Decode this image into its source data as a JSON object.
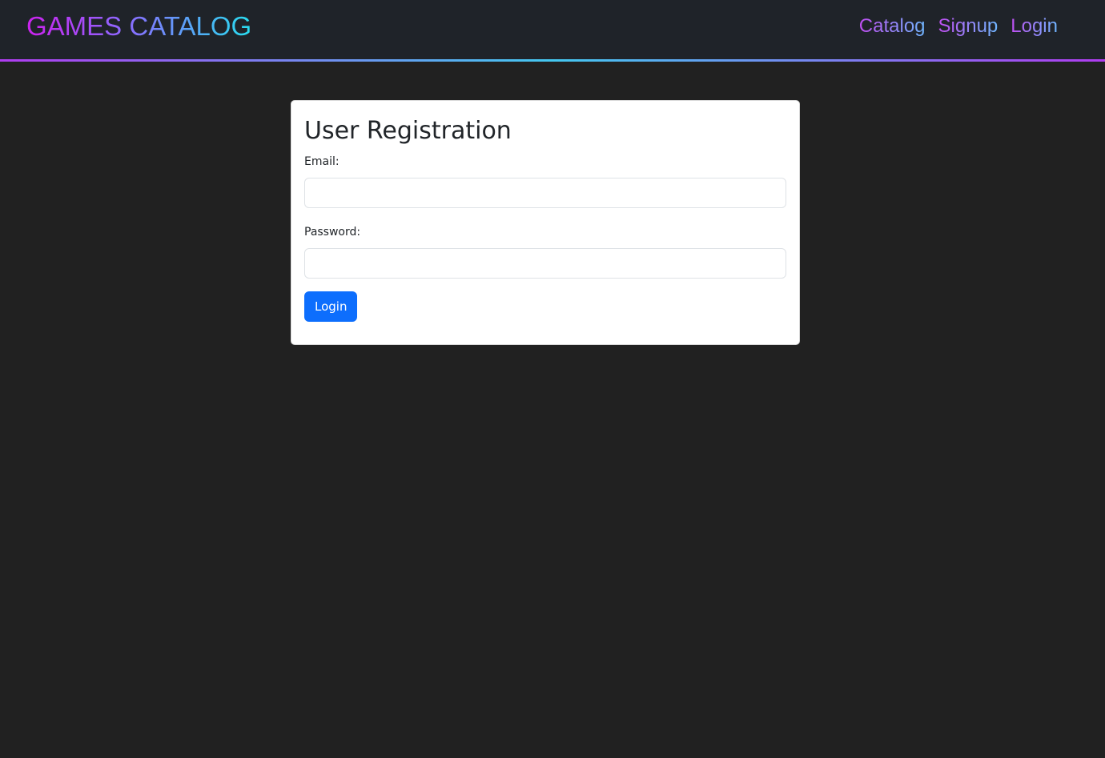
{
  "navbar": {
    "brand": "GAMES CATALOG",
    "links": [
      {
        "label": "Catalog"
      },
      {
        "label": "Signup"
      },
      {
        "label": "Login"
      }
    ],
    "colors": {
      "background": "#1f2329",
      "brand_gradient_start": "#cc22ee",
      "brand_gradient_end": "#28ddf0",
      "underline_gradient": [
        "#b03cf0",
        "#44c8f0"
      ]
    }
  },
  "form": {
    "title": "User Registration",
    "email_label": "Email:",
    "email_value": "",
    "password_label": "Password:",
    "password_value": "",
    "submit_label": "Login",
    "colors": {
      "submit_button": "#0d6efd",
      "card_background": "#ffffff"
    }
  },
  "page": {
    "background": "#212121"
  }
}
